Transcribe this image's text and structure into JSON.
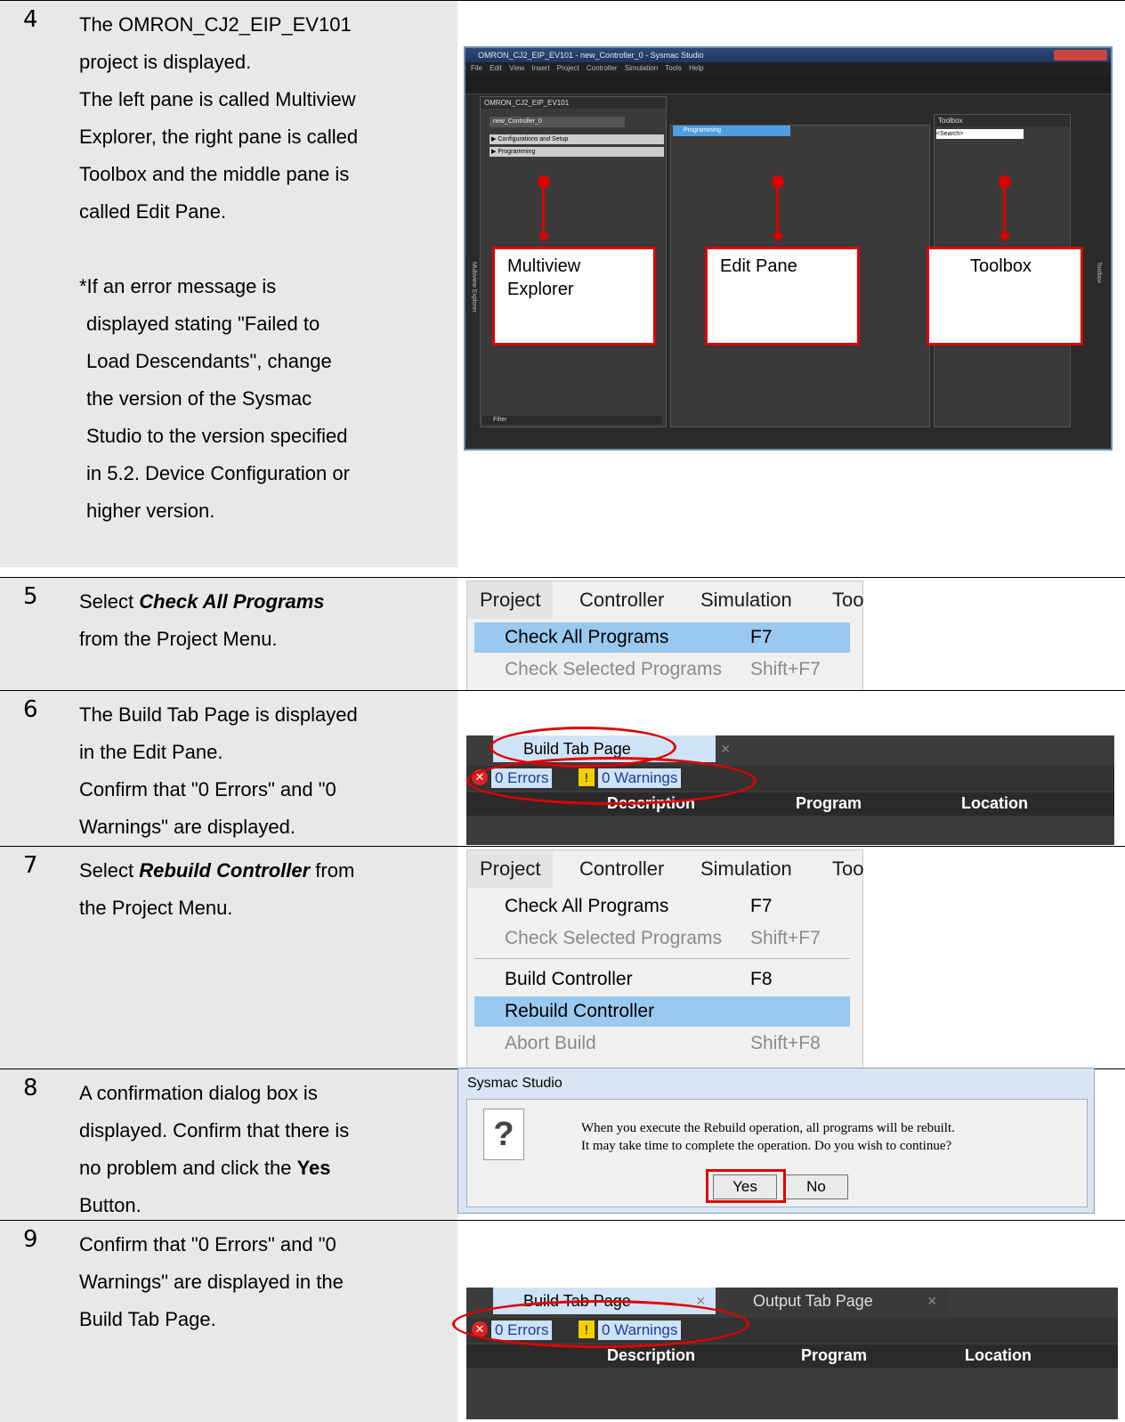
{
  "steps": [
    {
      "num": "4",
      "lines": [
        "The OMRON_CJ2_EIP_EV101",
        "project is displayed.",
        "The left pane is called Multiview",
        "Explorer, the right pane is called",
        "Toolbox and the middle pane is",
        "called Edit Pane."
      ],
      "note": [
        "*If an error message is",
        "displayed stating \"Failed to",
        "Load Descendants\", change",
        "the version of the Sysmac",
        "Studio to the version specified",
        "in 5.2. Device Configuration or",
        "higher version."
      ]
    },
    {
      "num": "5",
      "pre": "Select ",
      "bold": "Check All Programs",
      "line2": "from the Project Menu."
    },
    {
      "num": "6",
      "lines": [
        "The Build Tab Page is displayed",
        "in the Edit Pane.",
        "Confirm that \"0 Errors\" and \"0",
        "Warnings\" are displayed."
      ]
    },
    {
      "num": "7",
      "pre": "Select ",
      "bold": "Rebuild Controller",
      "post": " from",
      "line2": "the Project Menu."
    },
    {
      "num": "8",
      "lines": [
        "A confirmation dialog box is",
        "displayed. Confirm that there is"
      ],
      "pre": "no problem and click the ",
      "bold": "Yes",
      "line4": "Button."
    },
    {
      "num": "9",
      "lines": [
        "Confirm that \"0 Errors\" and \"0",
        "Warnings\" are displayed in the",
        "Build Tab Page."
      ]
    }
  ],
  "app": {
    "title": "OMRON_CJ2_EIP_EV101 - new_Controller_0 - Sysmac Studio",
    "menu": "File Edit View Insert Project Controller Simulation Tools Help",
    "explorer_title": "OMRON_CJ2_EIP_EV101",
    "controller": "new_Controller_0",
    "config": "▶ Configurations and Setup",
    "programming_item": "▶ Programming",
    "programming_tab": "Programming",
    "toolbox_title": "Toolbox",
    "search": "<Search>",
    "filter": "Filter",
    "side_left": "Multiview Explorer",
    "side_right": "Toolbox",
    "labels": {
      "explorer": [
        "Multiview",
        "Explorer"
      ],
      "edit": "Edit Pane",
      "toolbox": "Toolbox"
    }
  },
  "menu": {
    "bar": [
      "Project",
      "Controller",
      "Simulation",
      "Too"
    ],
    "check_all": "Check All Programs",
    "check_all_key": "F7",
    "check_sel": "Check Selected Programs",
    "check_sel_key": "Shift+F7",
    "build": "Build Controller",
    "build_key": "F8",
    "rebuild": "Rebuild Controller",
    "abort": "Abort Build",
    "abort_key": "Shift+F8"
  },
  "build": {
    "tab": "Build Tab Page",
    "close": "×",
    "output_tab": "Output Tab Page",
    "errors": "0 Errors",
    "warnings": "0 Warnings",
    "cols": [
      "Description",
      "Program",
      "Location"
    ]
  },
  "dialog": {
    "title": "Sysmac Studio",
    "line1": "When you execute the Rebuild operation, all programs will be rebuilt.",
    "line2": "It may take time to complete the operation. Do you wish to continue?",
    "yes": "Yes",
    "no": "No"
  }
}
